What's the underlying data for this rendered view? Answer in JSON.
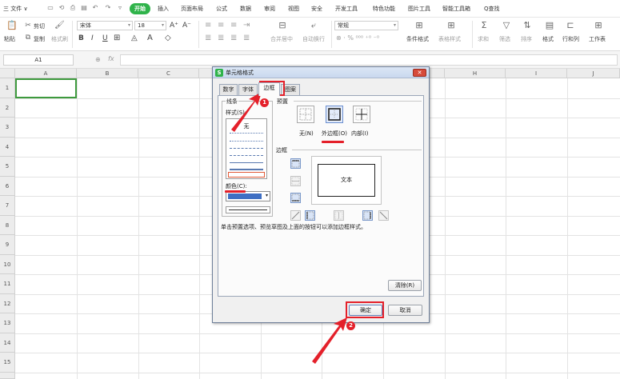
{
  "menu": {
    "file_label": "三 文件 ∨",
    "items": [
      "开始",
      "插入",
      "页面布局",
      "公式",
      "数据",
      "审阅",
      "视图",
      "安全",
      "开发工具",
      "特色功能",
      "图片工具",
      "智能工具箱",
      "Q查找"
    ]
  },
  "toolbar": {
    "paste": "粘贴",
    "cut": "剪切",
    "copy": "复制",
    "format_painter": "格式刷",
    "font_name": "宋体",
    "font_size": "18",
    "merge": "合并居中",
    "wrap": "自动换行",
    "number_format": "常规",
    "conditional_format": "条件格式",
    "table_style": "表格样式",
    "sum": "求和",
    "filter": "筛选",
    "sort": "排序",
    "format": "格式",
    "row_col": "行和列",
    "sheet": "工作表"
  },
  "formula_bar": {
    "cell_ref": "A1",
    "fx": "fx"
  },
  "grid": {
    "columns": [
      "A",
      "B",
      "C",
      "D",
      "E",
      "F",
      "G",
      "H",
      "I",
      "J"
    ],
    "rows": [
      "1",
      "2",
      "3",
      "4",
      "5",
      "6",
      "7",
      "8",
      "9",
      "10",
      "11",
      "12",
      "13",
      "14",
      "15"
    ]
  },
  "dialog": {
    "title": "单元格格式",
    "logo": "S",
    "close": "✕",
    "tabs": [
      "数字",
      "字体",
      "边框",
      "图案"
    ],
    "active_tab": "边框",
    "line_group": "线条",
    "style_label": "样式(S):",
    "style_none": "无",
    "color_label": "颜色(C):",
    "color_value": "#3f6fc3",
    "preset_group": "预置",
    "presets": [
      "无(N)",
      "外边框(O)",
      "内部(I)"
    ],
    "border_group": "边框",
    "preview_text": "文本",
    "hint": "单击预置选项、预览草图及上面的按钮可以添加边框样式。",
    "clear_button": "清除(R)",
    "ok_button": "确定",
    "cancel_button": "取消"
  },
  "annotations": {
    "step1": "1",
    "step2": "2",
    "highlight_color": "#e4202a"
  }
}
